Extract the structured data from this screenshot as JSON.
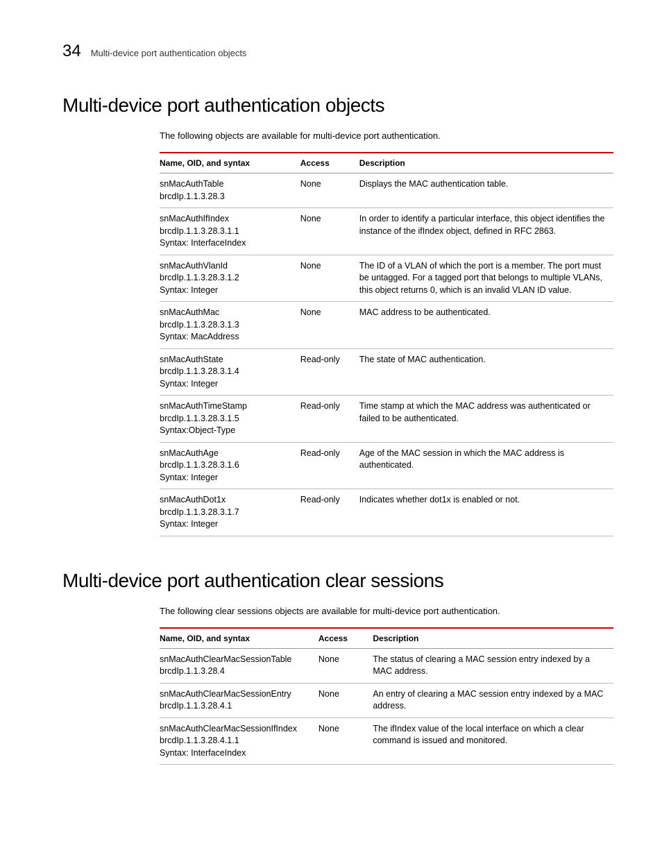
{
  "header": {
    "page_number": "34",
    "title": "Multi-device port authentication objects"
  },
  "section1": {
    "heading": "Multi-device port authentication objects",
    "intro": "The following objects are available for multi-device port authentication.",
    "columns": {
      "name": "Name, OID, and syntax",
      "access": "Access",
      "description": "Description"
    },
    "rows": [
      {
        "name1": "snMacAuthTable",
        "name2": "brcdIp.1.1.3.28.3",
        "name3": "",
        "access": "None",
        "description": "Displays the MAC authentication table."
      },
      {
        "name1": "snMacAuthIfIndex",
        "name2": "brcdIp.1.1.3.28.3.1.1",
        "name3": "Syntax: InterfaceIndex",
        "access": "None",
        "description": "In order to identify a particular interface, this object identifies the instance of the ifIndex object, defined in RFC 2863."
      },
      {
        "name1": "snMacAuthVlanId",
        "name2": "brcdIp.1.1.3.28.3.1.2",
        "name3": "Syntax: Integer",
        "access": "None",
        "description": "The ID of a VLAN of which the port is a member. The port must be untagged. For a tagged port that belongs to multiple VLANs, this object returns 0, which is an invalid VLAN ID value."
      },
      {
        "name1": "snMacAuthMac",
        "name2": "brcdIp.1.1.3.28.3.1.3",
        "name3": "Syntax: MacAddress",
        "access": "None",
        "description": "MAC address to be authenticated."
      },
      {
        "name1": "snMacAuthState",
        "name2": "brcdIp.1.1.3.28.3.1.4",
        "name3": "Syntax: Integer",
        "access": "Read-only",
        "description": "The state of MAC authentication."
      },
      {
        "name1": "snMacAuthTimeStamp",
        "name2": "brcdIp.1.1.3.28.3.1.5",
        "name3": "Syntax:Object-Type",
        "access": "Read-only",
        "description": "Time stamp at which the MAC address was authenticated or failed to be authenticated."
      },
      {
        "name1": "snMacAuthAge",
        "name2": "brcdIp.1.1.3.28.3.1.6",
        "name3": "Syntax: Integer",
        "access": "Read-only",
        "description": "Age of the MAC session in which the MAC address is authenticated."
      },
      {
        "name1": "snMacAuthDot1x",
        "name2": "brcdIp.1.1.3.28.3.1.7",
        "name3": "Syntax: Integer",
        "access": "Read-only",
        "description": "Indicates whether dot1x is enabled or not."
      }
    ]
  },
  "section2": {
    "heading": "Multi-device port authentication clear sessions",
    "intro": "The following clear sessions objects are available for multi-device port authentication.",
    "columns": {
      "name": "Name, OID, and syntax",
      "access": "Access",
      "description": "Description"
    },
    "rows": [
      {
        "name1": "snMacAuthClearMacSessionTable",
        "name2": "brcdIp.1.1.3.28.4",
        "name3": "",
        "access": "None",
        "description": "The status of clearing a MAC session entry indexed by a MAC address."
      },
      {
        "name1": "snMacAuthClearMacSessionEntry",
        "name2": "brcdIp.1.1.3.28.4.1",
        "name3": "",
        "access": "None",
        "description": "An entry of clearing a MAC session entry indexed by a MAC address."
      },
      {
        "name1": "snMacAuthClearMacSessionIfIndex",
        "name2": "brcdIp.1.1.3.28.4.1.1",
        "name3": "Syntax: InterfaceIndex",
        "access": "None",
        "description": "The ifIndex value of the local interface on which a clear command is issued and monitored."
      }
    ]
  }
}
